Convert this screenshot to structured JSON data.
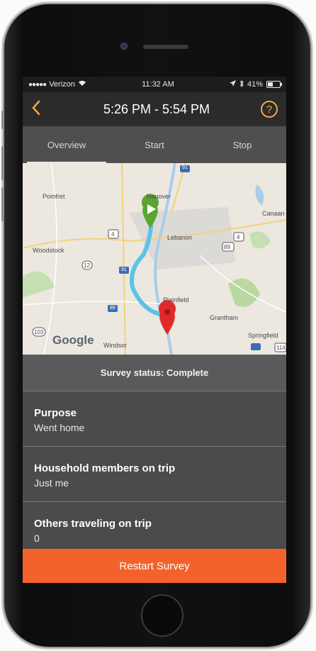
{
  "status_bar": {
    "carrier": "Verizon",
    "time": "11:32 AM",
    "battery": "41%"
  },
  "nav": {
    "back_icon": "chevron-left-icon",
    "title": "5:26 PM - 5:54 PM",
    "help_icon": "question-circle-icon",
    "accent_color": "#f7a64a"
  },
  "tabs": [
    {
      "label": "Overview",
      "active": true
    },
    {
      "label": "Start",
      "active": false
    },
    {
      "label": "Stop",
      "active": false
    }
  ],
  "map": {
    "places": [
      "Pomfret",
      "Hanover",
      "Canaan",
      "Lebanon",
      "Woodstock",
      "Plainfield",
      "Grantham",
      "Springfield",
      "Windsor"
    ],
    "route_numbers": [
      "91",
      "4",
      "12",
      "4",
      "89",
      "91",
      "89",
      "103",
      "114"
    ],
    "start_marker_color": "#5aa532",
    "end_marker_color": "#e02a2a",
    "route_color": "#5cc3e6",
    "logo": "Google"
  },
  "survey": {
    "status_text": "Survey status: Complete",
    "items": [
      {
        "title": "Purpose",
        "value": "Went home"
      },
      {
        "title": "Household members on trip",
        "value": "Just me"
      },
      {
        "title": "Others traveling on trip",
        "value": "0"
      }
    ],
    "restart_label": "Restart Survey",
    "restart_color": "#f3622c"
  }
}
